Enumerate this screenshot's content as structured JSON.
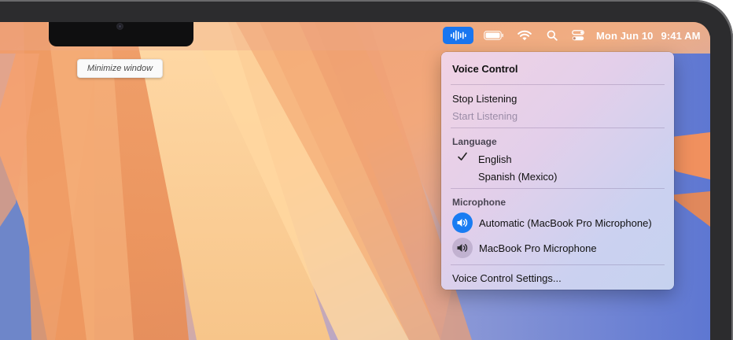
{
  "tooltip": {
    "text": "Minimize window"
  },
  "menubar": {
    "voice_control_icon": "voice-control-waveform-icon",
    "battery_icon": "battery-icon",
    "wifi_icon": "wifi-icon",
    "search_icon": "spotlight-search-icon",
    "control_center_icon": "control-center-icon",
    "date": "Mon Jun 10",
    "time": "9:41 AM",
    "active_color": "#1976f0"
  },
  "menu": {
    "title": "Voice Control",
    "stop_listening": "Stop Listening",
    "start_listening": "Start Listening",
    "language_header": "Language",
    "languages": [
      {
        "label": "English",
        "selected": true
      },
      {
        "label": "Spanish (Mexico)",
        "selected": false
      }
    ],
    "microphone_header": "Microphone",
    "microphones": [
      {
        "label": "Automatic (MacBook Pro Microphone)",
        "selected": true,
        "icon": "speaker-icon"
      },
      {
        "label": "MacBook Pro Microphone",
        "selected": false,
        "icon": "speaker-icon"
      }
    ],
    "settings": "Voice Control Settings..."
  }
}
